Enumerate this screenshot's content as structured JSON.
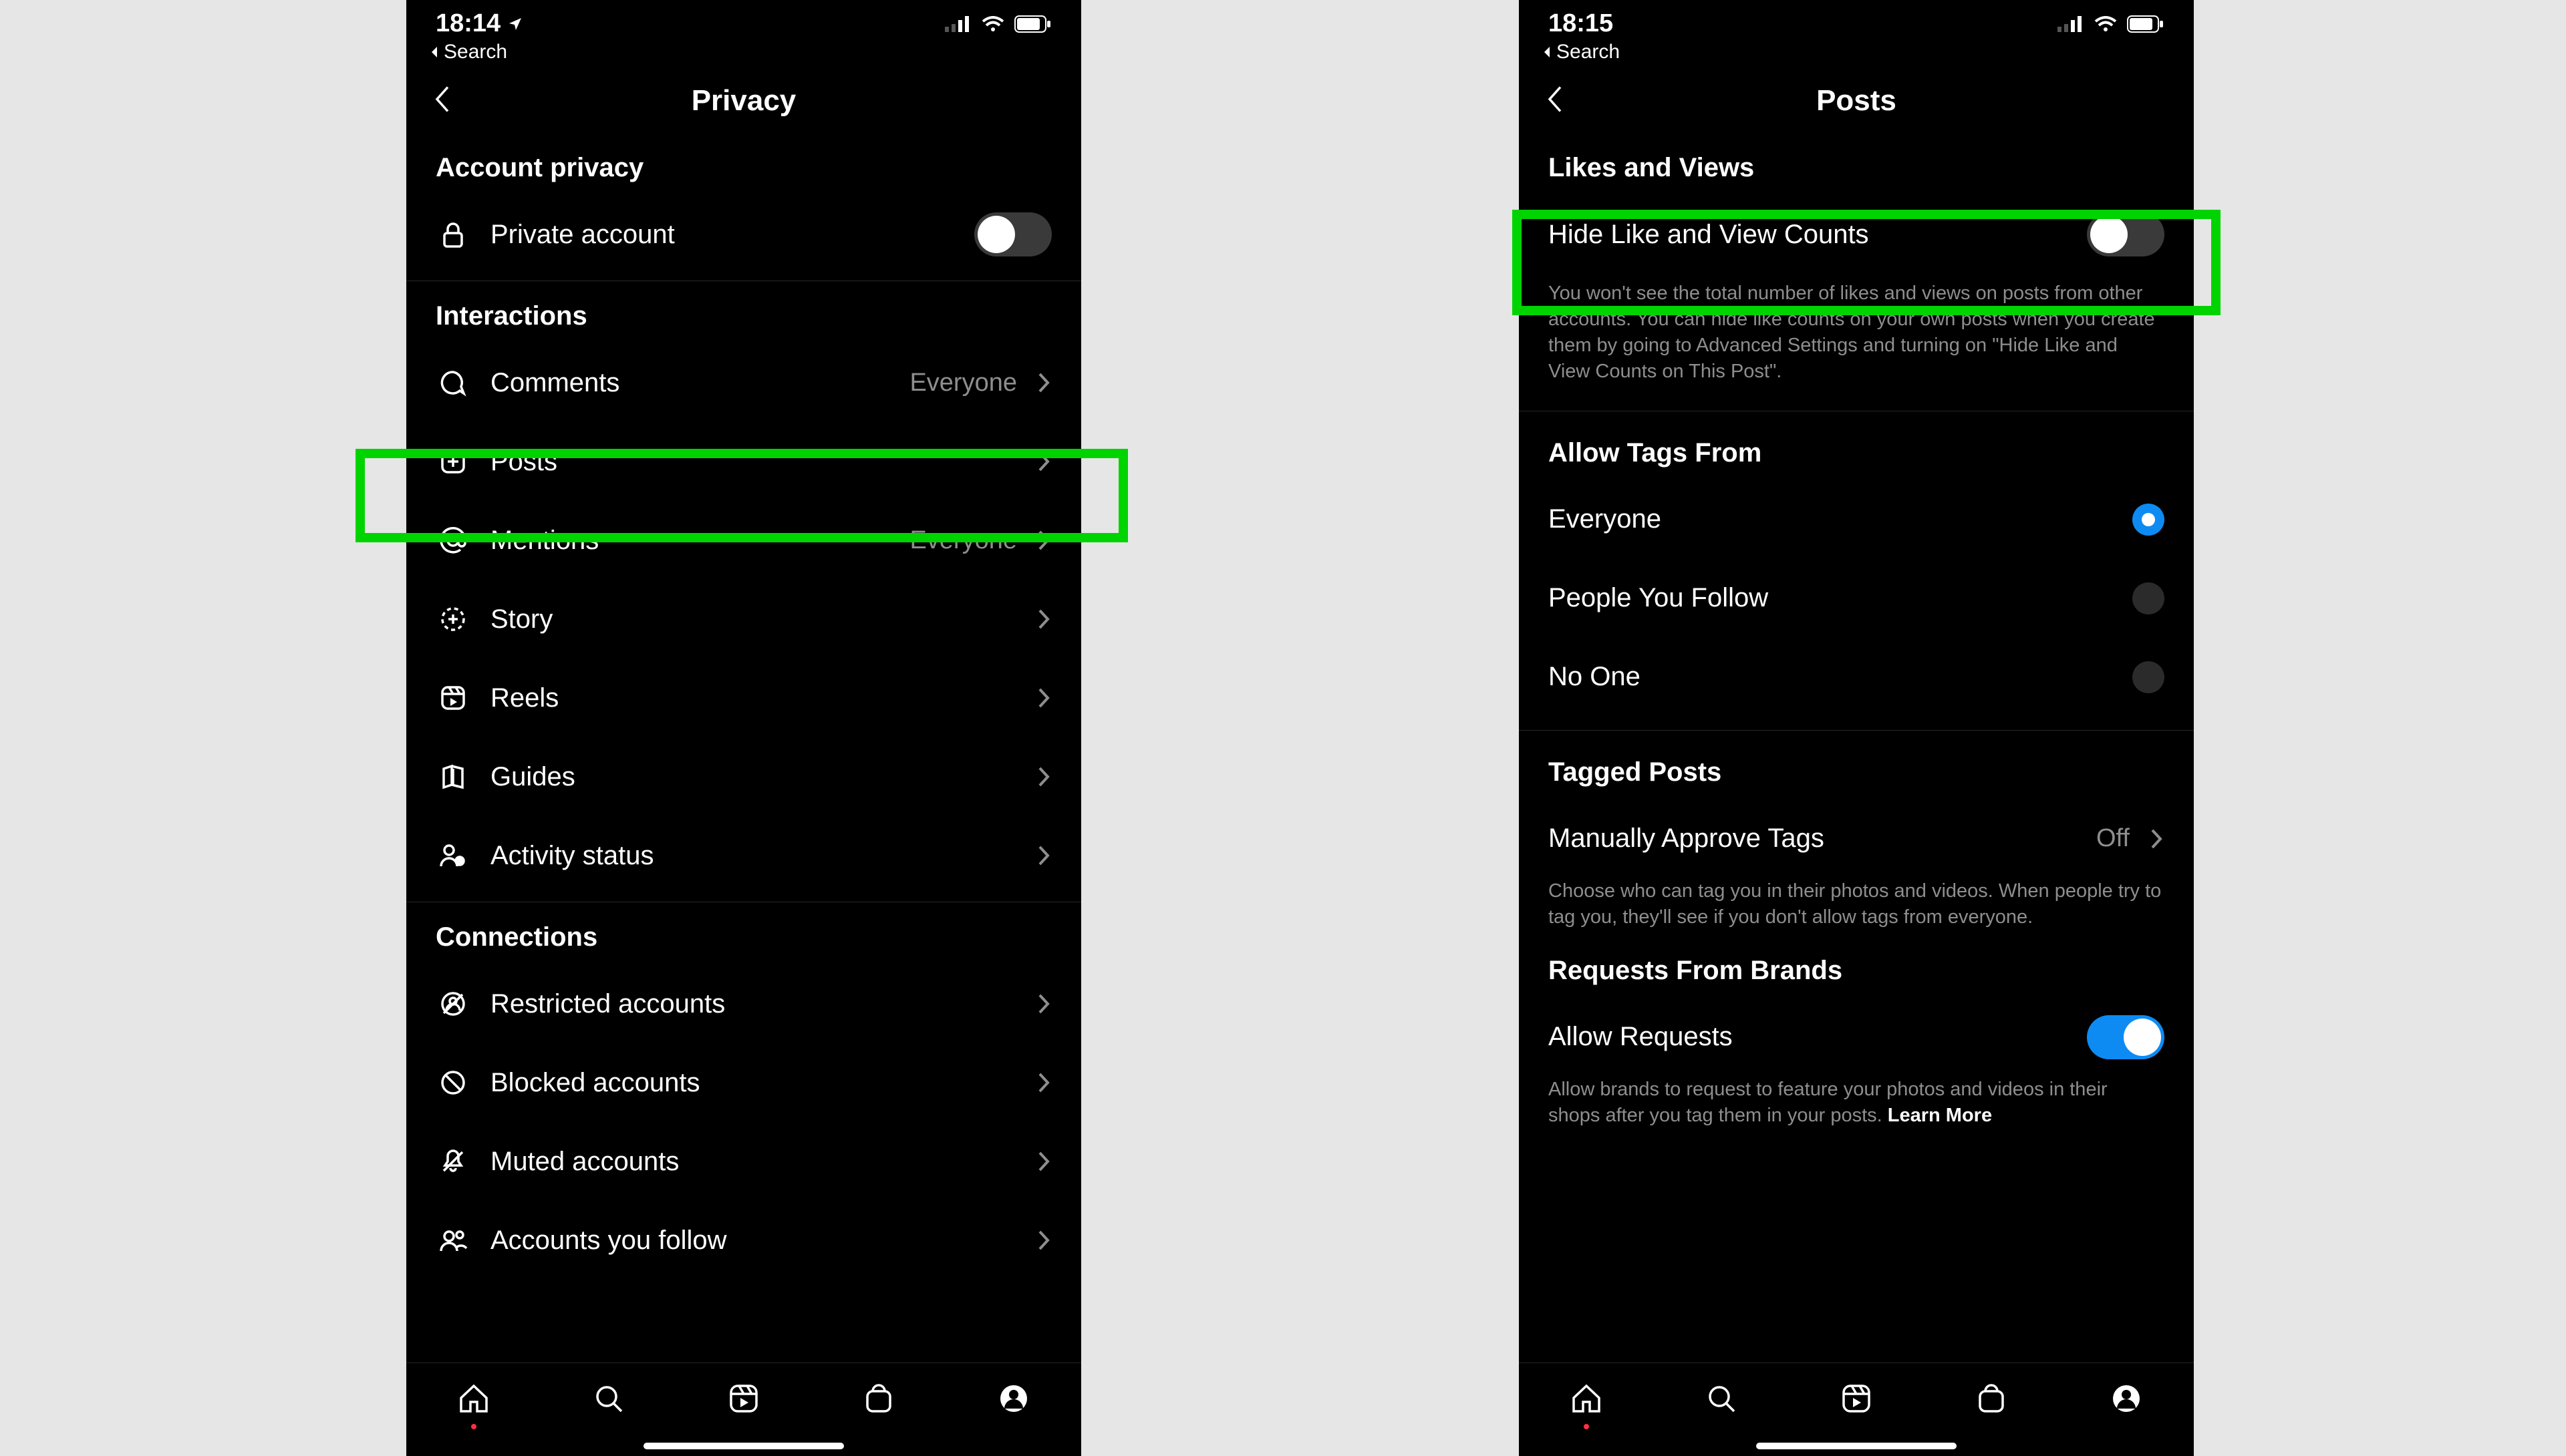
{
  "colors": {
    "highlight": "#00d400",
    "toggle_on": "#0d8bf2",
    "radio_selected": "#0d8bf2"
  },
  "left": {
    "status": {
      "time": "18:14",
      "location_arrow": true
    },
    "breadcrumb": {
      "back_label": "Search"
    },
    "title": "Privacy",
    "sections": {
      "account_privacy": {
        "header": "Account privacy",
        "private_account": {
          "label": "Private account",
          "on": false
        }
      },
      "interactions": {
        "header": "Interactions",
        "items": [
          {
            "key": "comments",
            "label": "Comments",
            "value": "Everyone"
          },
          {
            "key": "posts",
            "label": "Posts",
            "value": ""
          },
          {
            "key": "mentions",
            "label": "Mentions",
            "value": "Everyone"
          },
          {
            "key": "story",
            "label": "Story",
            "value": ""
          },
          {
            "key": "reels",
            "label": "Reels",
            "value": ""
          },
          {
            "key": "guides",
            "label": "Guides",
            "value": ""
          },
          {
            "key": "activity",
            "label": "Activity status",
            "value": ""
          }
        ]
      },
      "connections": {
        "header": "Connections",
        "items": [
          {
            "key": "restricted",
            "label": "Restricted accounts"
          },
          {
            "key": "blocked",
            "label": "Blocked accounts"
          },
          {
            "key": "muted",
            "label": "Muted accounts"
          },
          {
            "key": "following",
            "label": "Accounts you follow"
          }
        ]
      }
    }
  },
  "right": {
    "status": {
      "time": "18:15",
      "location_arrow": false
    },
    "breadcrumb": {
      "back_label": "Search"
    },
    "title": "Posts",
    "likes_views": {
      "header": "Likes and Views",
      "toggle": {
        "label": "Hide Like and View Counts",
        "on": false
      },
      "help": "You won't see the total number of likes and views on posts from other accounts. You can hide like counts on your own posts when you create them by going to Advanced Settings and turning on \"Hide Like and View Counts on This Post\"."
    },
    "allow_tags": {
      "header": "Allow Tags From",
      "options": [
        {
          "key": "everyone",
          "label": "Everyone",
          "selected": true
        },
        {
          "key": "people",
          "label": "People You Follow",
          "selected": false
        },
        {
          "key": "noone",
          "label": "No One",
          "selected": false
        }
      ]
    },
    "tagged_posts": {
      "header": "Tagged Posts",
      "manually_approve": {
        "label": "Manually Approve Tags",
        "value": "Off"
      },
      "help": "Choose who can tag you in their photos and videos. When people try to tag you, they'll see if you don't allow tags from everyone."
    },
    "brand_requests": {
      "header": "Requests From Brands",
      "toggle": {
        "label": "Allow Requests",
        "on": true
      },
      "help": "Allow brands to request to feature your photos and videos in their shops after you tag them in your posts.",
      "learn_more": "Learn More"
    }
  }
}
